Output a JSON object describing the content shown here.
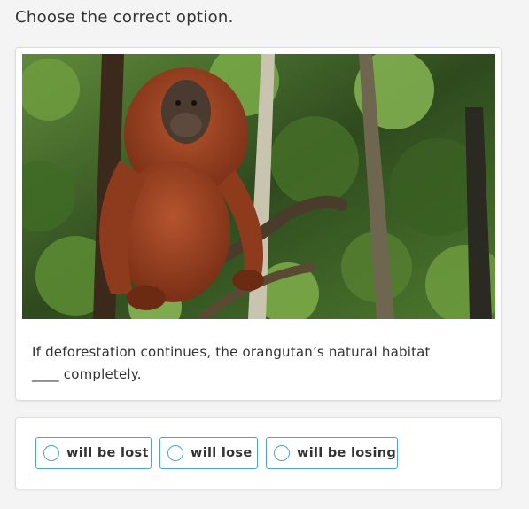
{
  "instruction": "Choose the correct option.",
  "question": {
    "line1": "If deforestation continues, the orangutan’s natural habitat",
    "line2": "____ completely."
  },
  "options": [
    {
      "label": "will be lost"
    },
    {
      "label": "will lose"
    },
    {
      "label": "will be losing"
    }
  ],
  "colors": {
    "accent": "#49a7d4",
    "background": "#f4f4f4",
    "card": "#ffffff"
  }
}
